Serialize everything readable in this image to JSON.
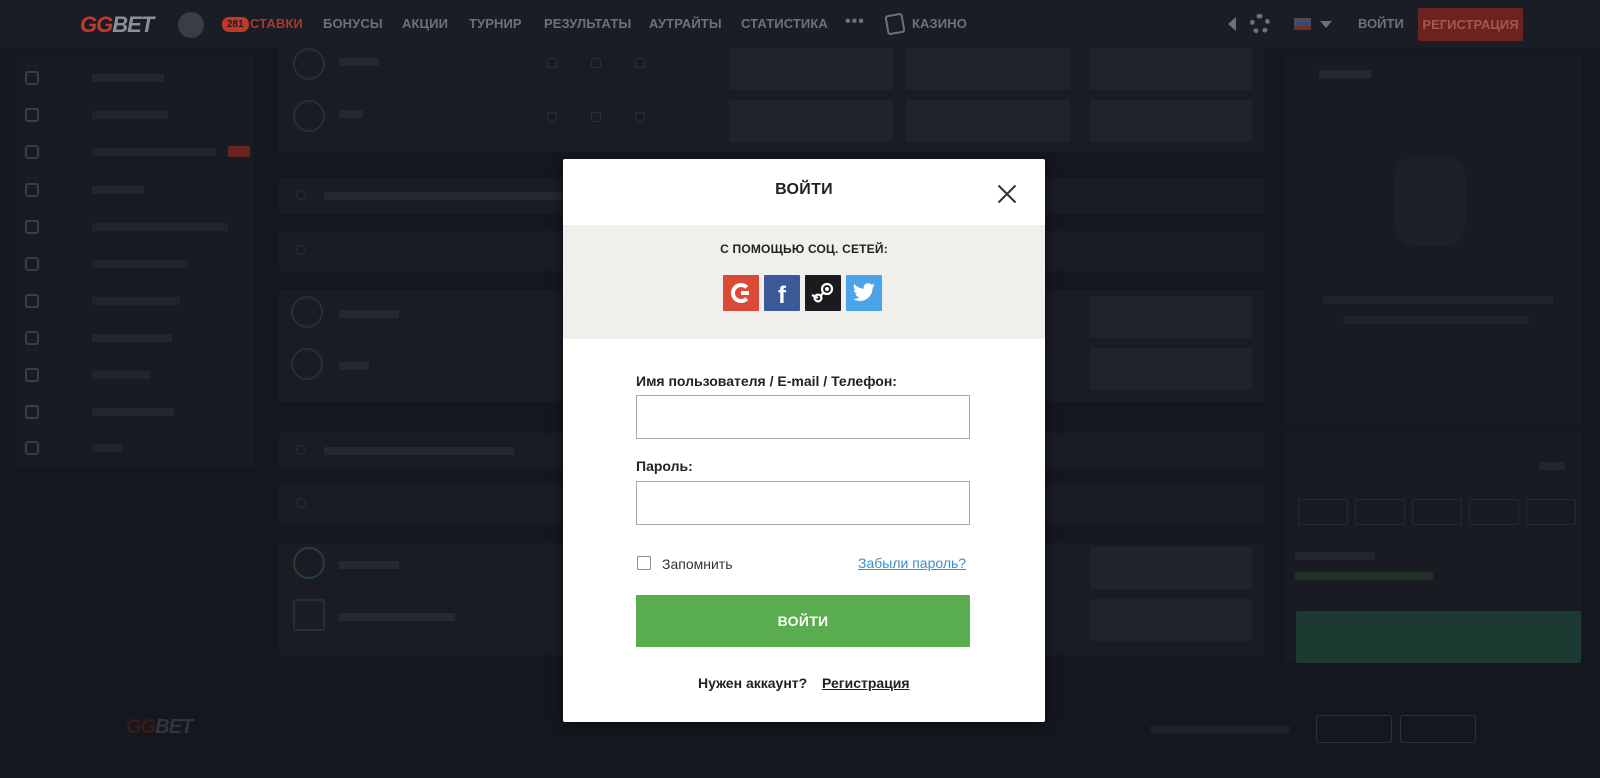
{
  "nav": {
    "logo_gg": "GG",
    "logo_bet": "BET",
    "badge": "281",
    "items": [
      "СТАВКИ",
      "БОНУСЫ",
      "АКЦИИ",
      "ТУРНИР",
      "РЕЗУЛЬТАТЫ",
      "АУТРАЙТЫ",
      "СТАТИСТИКА"
    ],
    "more": "•••",
    "casino": "КАЗИНО",
    "login": "ВОЙТИ",
    "register": "РЕГИСТРАЦИЯ"
  },
  "footer": {
    "logo_gg": "GG",
    "logo_bet": "BET"
  },
  "modal": {
    "title": "ВОЙТИ",
    "social_title": "С ПОМОЩЬЮ СОЦ. СЕТЕЙ:",
    "social": [
      "google-icon",
      "facebook-icon",
      "steam-icon",
      "twitter-icon"
    ],
    "facebook_glyph": "f",
    "username_label": "Имя пользователя / E-mail / Телефон:",
    "username_value": "",
    "password_label": "Пароль:",
    "password_value": "",
    "remember_label": "Запомнить",
    "forgot_link": "Забыли пароль?",
    "submit": "ВОЙТИ",
    "need_account": "Нужен аккаунт?",
    "register_link": "Регистрация"
  },
  "colors": {
    "accent_green": "#5aad4e",
    "link_blue": "#3a8fd0",
    "google": "#db4a39",
    "facebook": "#3b5998",
    "steam": "#1b1b1f",
    "twitter": "#4aa4e8"
  }
}
